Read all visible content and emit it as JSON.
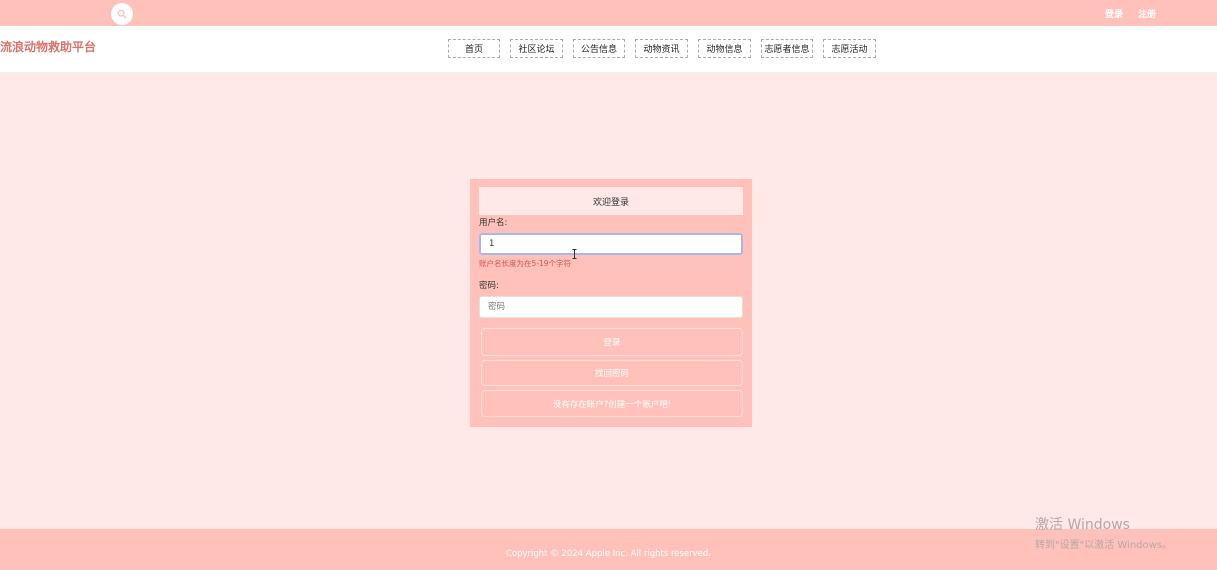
{
  "topbar": {
    "search_icon": "search-icon",
    "links": {
      "login": "登录",
      "register": "注册"
    }
  },
  "header": {
    "site_title": "流浪动物救助平台",
    "nav": [
      "首页",
      "社区论坛",
      "公告信息",
      "动物资讯",
      "动物信息",
      "志愿者信息",
      "志愿活动"
    ]
  },
  "login": {
    "welcome": "欢迎登录",
    "username_label": "用户名:",
    "username_value": "1",
    "username_error": "账户名长度为在5-19个字符",
    "password_label": "密码:",
    "password_placeholder": "密码",
    "login_button": "登录",
    "forgot_button": "找回密码",
    "register_button": "没有存在账户?创建一个账户吧!"
  },
  "footer": {
    "copyright": "Copyright © 2024 Apple Inc. All rights reserved."
  },
  "watermark": {
    "title": "激活 Windows",
    "subtitle": "转到\"设置\"以激活 Windows。"
  },
  "colors": {
    "topbar": "#ffc1b9",
    "page_background": "#ffe8e6",
    "site_title": "#d6766b",
    "error": "#d9534f"
  }
}
